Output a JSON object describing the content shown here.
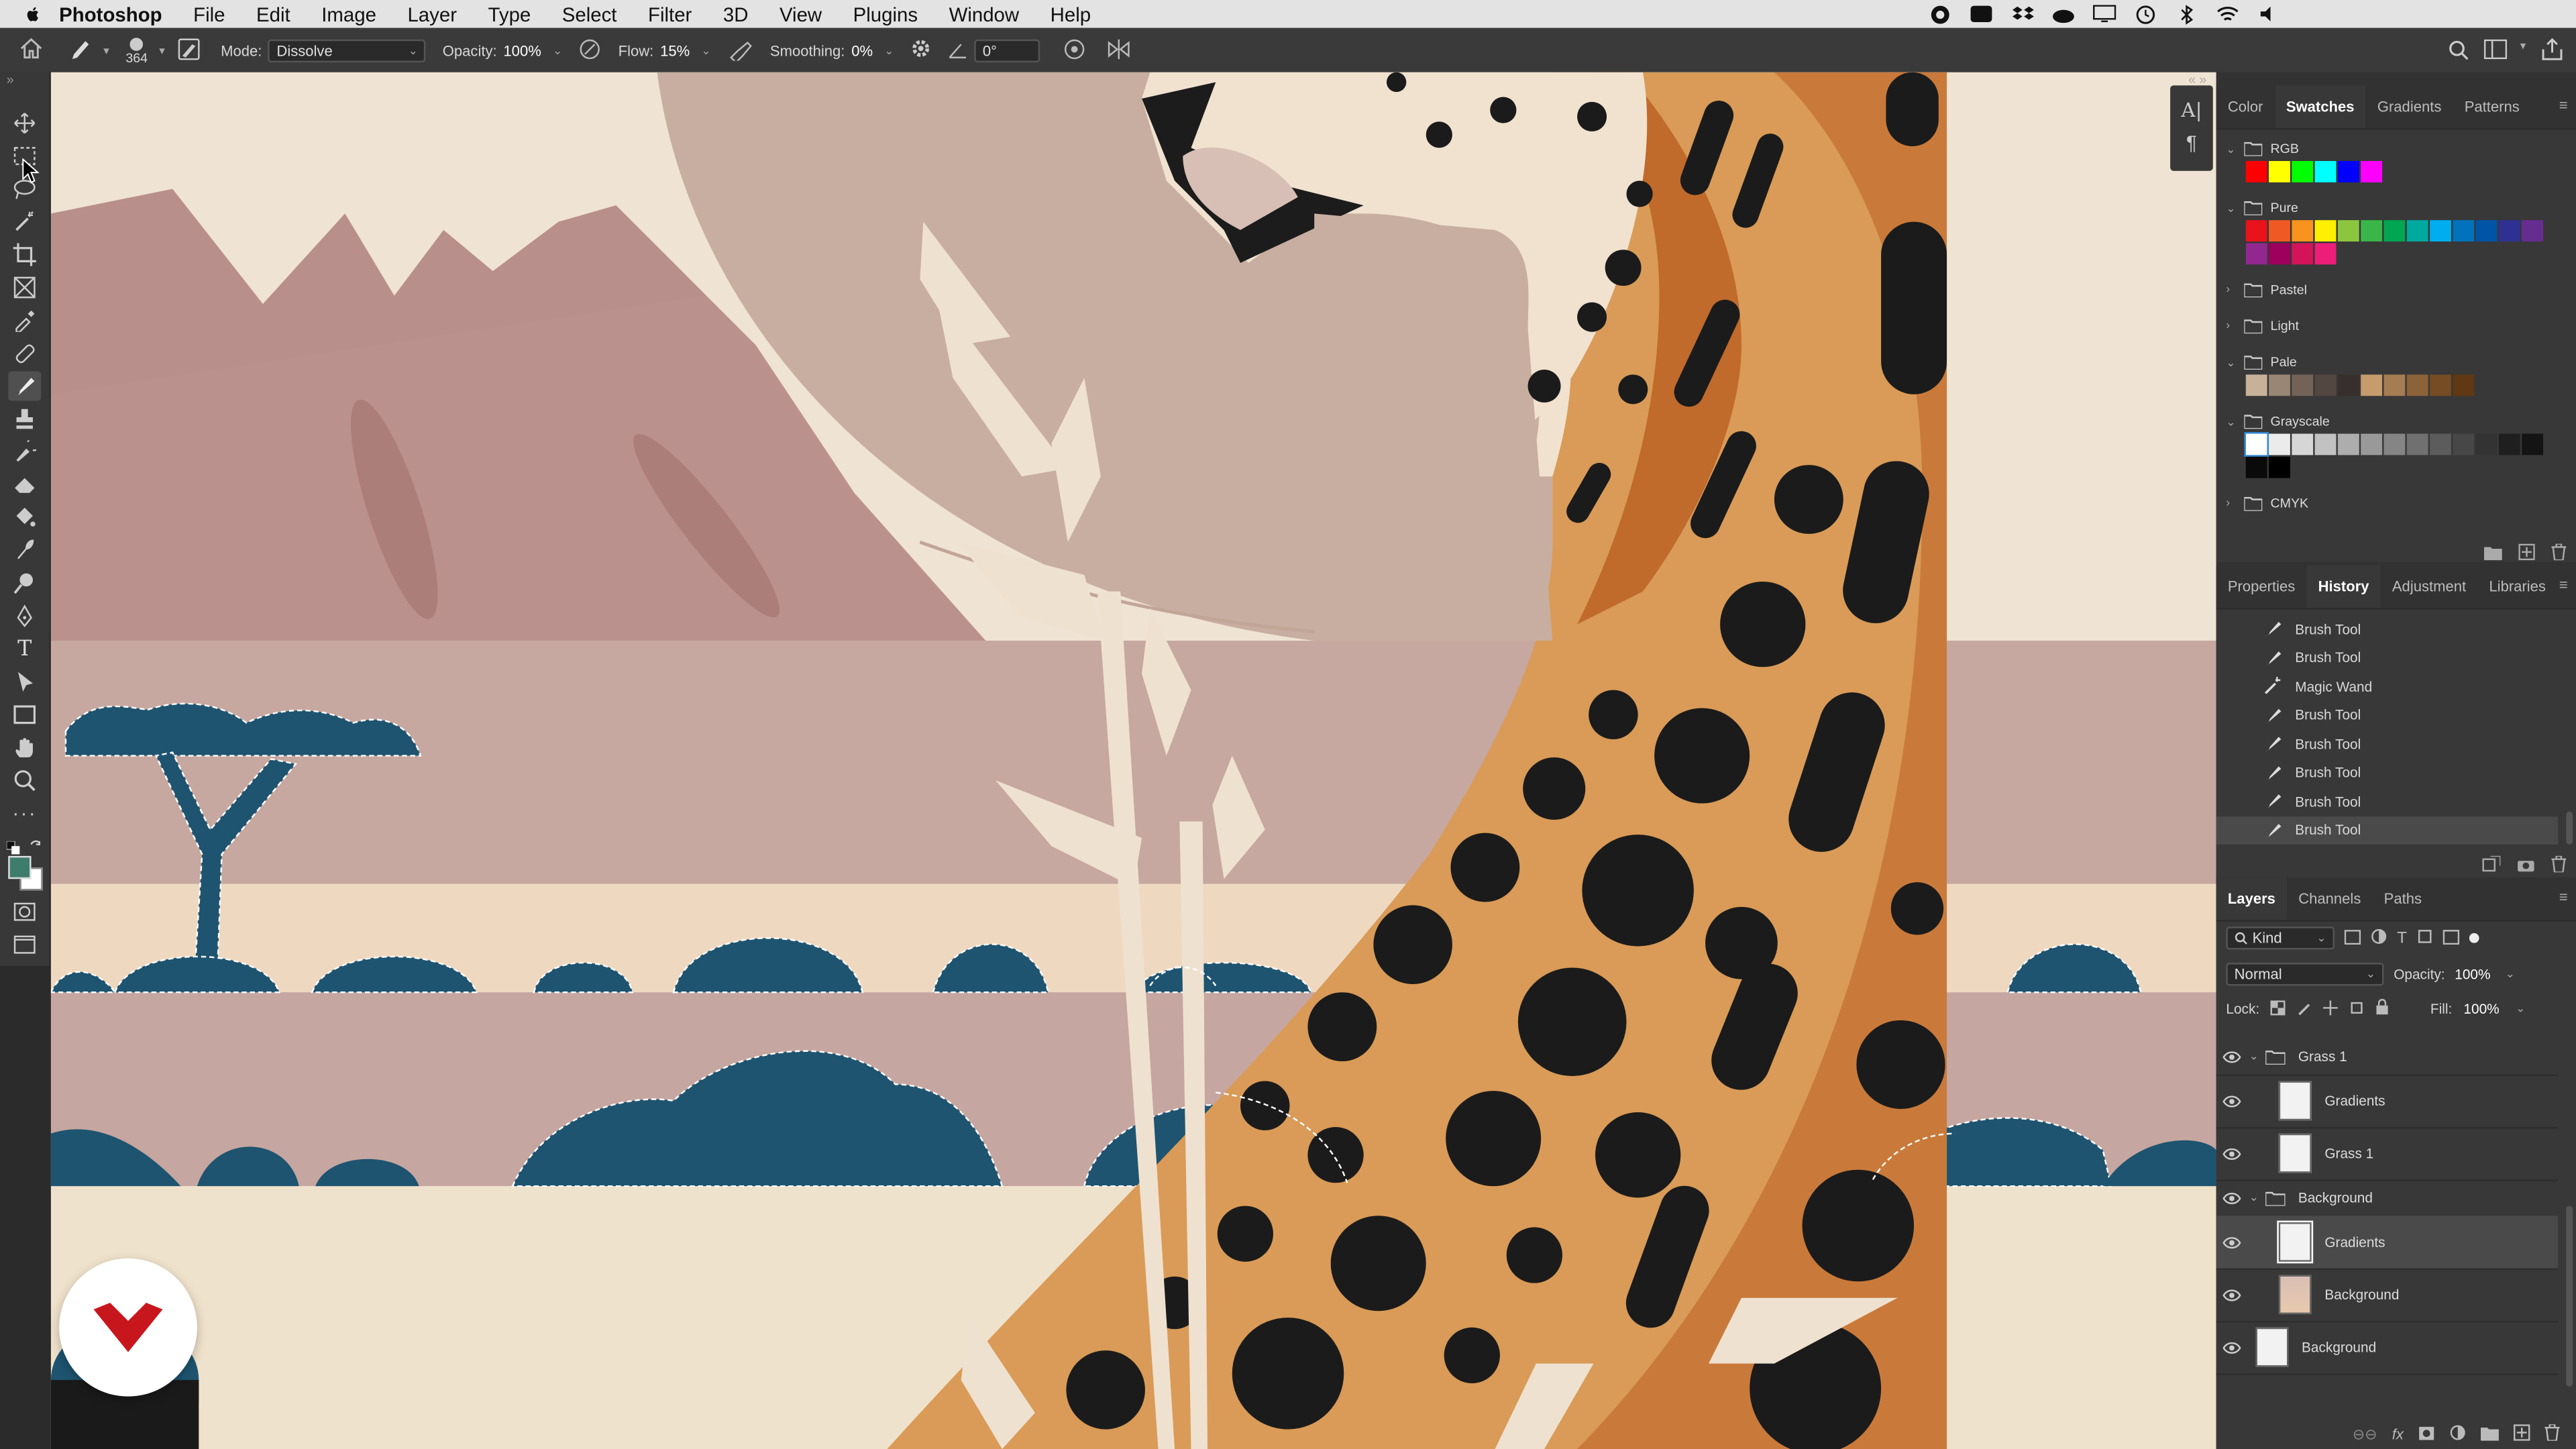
{
  "menubar": {
    "app": "Photoshop",
    "items": [
      "File",
      "Edit",
      "Image",
      "Layer",
      "Type",
      "Select",
      "Filter",
      "3D",
      "View",
      "Plugins",
      "Window",
      "Help"
    ]
  },
  "options": {
    "brush_size": "364",
    "mode_label": "Mode:",
    "mode_value": "Dissolve",
    "opacity_label": "Opacity:",
    "opacity_value": "100%",
    "flow_label": "Flow:",
    "flow_value": "15%",
    "smoothing_label": "Smoothing:",
    "smoothing_value": "0%",
    "angle_value": "0°"
  },
  "swatches": {
    "tabs": [
      "Color",
      "Swatches",
      "Gradients",
      "Patterns"
    ],
    "active_tab": "Swatches",
    "groups": [
      {
        "name": "RGB",
        "expanded": true,
        "colors": [
          "#ff0000",
          "#ffff00",
          "#00ff00",
          "#00ffff",
          "#0000ff",
          "#ff00ff"
        ]
      },
      {
        "name": "Pure",
        "expanded": true,
        "colors": [
          "#e8131b",
          "#ef5a24",
          "#f7931e",
          "#ffef00",
          "#8cc63f",
          "#39b54a",
          "#00a651",
          "#00a99d",
          "#00aeef",
          "#0072bc",
          "#0054a6",
          "#2e3192",
          "#662d91",
          "#92278f",
          "#9e005d",
          "#d4145a",
          "#ed1e79"
        ]
      },
      {
        "name": "Pastel",
        "expanded": false,
        "colors": []
      },
      {
        "name": "Light",
        "expanded": false,
        "colors": []
      },
      {
        "name": "Pale",
        "expanded": true,
        "colors": [
          "#c7b299",
          "#998675",
          "#736357",
          "#534741",
          "#362f2d",
          "#c69c6d",
          "#a67c52",
          "#8c6239",
          "#754c24",
          "#603813"
        ]
      },
      {
        "name": "Grayscale",
        "expanded": true,
        "colors": [
          "#ffffff",
          "#ebebeb",
          "#d6d6d6",
          "#c2c2c2",
          "#adadad",
          "#999999",
          "#858585",
          "#707070",
          "#5c5c5c",
          "#474747",
          "#333333",
          "#1f1f1f",
          "#141414",
          "#0a0a0a",
          "#000000"
        ]
      },
      {
        "name": "CMYK",
        "expanded": false,
        "colors": []
      }
    ]
  },
  "history": {
    "tabs": [
      "Properties",
      "History",
      "Adjustment",
      "Libraries"
    ],
    "active_tab": "History",
    "items": [
      "Brush Tool",
      "Brush Tool",
      "Magic Wand",
      "Brush Tool",
      "Brush Tool",
      "Brush Tool",
      "Brush Tool",
      "Brush Tool"
    ]
  },
  "layers": {
    "tabs": [
      "Layers",
      "Channels",
      "Paths"
    ],
    "active_tab": "Layers",
    "filter_value": "Kind",
    "blend_mode": "Normal",
    "opacity_label": "Opacity:",
    "opacity_value": "100%",
    "lock_label": "Lock:",
    "fill_label": "Fill:",
    "fill_value": "100%",
    "items": [
      {
        "name": "Grass 1",
        "type": "group"
      },
      {
        "name": "Gradients",
        "type": "layer"
      },
      {
        "name": "Grass 1",
        "type": "layer"
      },
      {
        "name": "Background",
        "type": "group"
      },
      {
        "name": "Gradients",
        "type": "layer",
        "selected": true
      },
      {
        "name": "Background",
        "type": "layer"
      },
      {
        "name": "Background",
        "type": "layer"
      }
    ]
  },
  "colors": {
    "accent_logo": "#c8161d",
    "sky": "#efe3d0",
    "mountain": "#b98f8b",
    "bush": "#1f5673",
    "cheetah": "#d89a55",
    "spots": "#1b1b1b"
  }
}
